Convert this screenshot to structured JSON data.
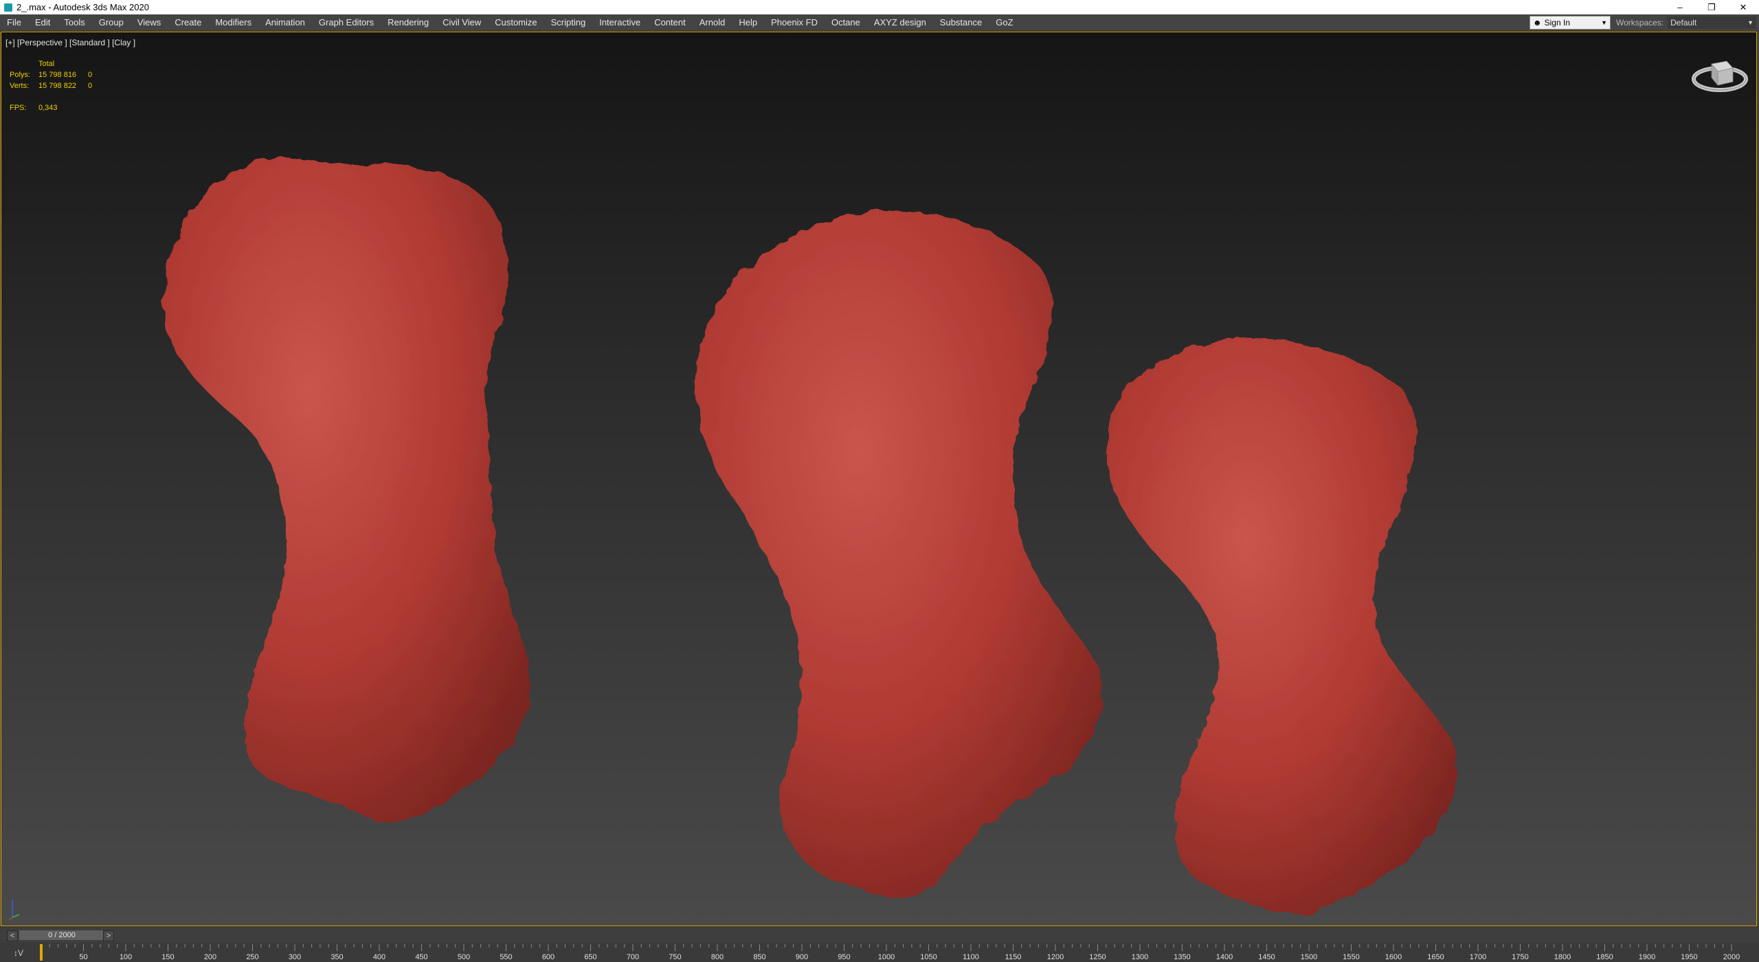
{
  "window": {
    "title": "2_.max - Autodesk 3ds Max 2020",
    "controls": {
      "minimize": "–",
      "restore": "❐",
      "close": "✕"
    }
  },
  "menu": {
    "items": [
      "File",
      "Edit",
      "Tools",
      "Group",
      "Views",
      "Create",
      "Modifiers",
      "Animation",
      "Graph Editors",
      "Rendering",
      "Civil View",
      "Customize",
      "Scripting",
      "Interactive",
      "Content",
      "Arnold",
      "Help",
      "Phoenix FD",
      "Octane",
      "AXYZ design",
      "Substance",
      "GoZ"
    ]
  },
  "account": {
    "sign_in": "Sign In"
  },
  "workspaces": {
    "label": "Workspaces:",
    "value": "Default"
  },
  "viewport": {
    "label": "[+] [Perspective ] [Standard ] [Clay ]",
    "stats": {
      "total_header": "Total",
      "polys_label": "Polys:",
      "polys_total": "15 798 816",
      "polys_selected": "0",
      "verts_label": "Verts:",
      "verts_total": "15 798 822",
      "verts_selected": "0",
      "fps_label": "FPS:",
      "fps_value": "0,343"
    },
    "rock_color": "#b83a34",
    "border_color": "#e0a800"
  },
  "timeslider": {
    "frame": "0 / 2000",
    "prev": "<",
    "next": ">"
  },
  "trackbar": {
    "icon": "↕V",
    "ticks": [
      50,
      100,
      150,
      200,
      250,
      300,
      350,
      400,
      450,
      500,
      550,
      600,
      650,
      700,
      750,
      800,
      850,
      900,
      950,
      1000,
      1050,
      1100,
      1150,
      1200,
      1250,
      1300,
      1350,
      1400,
      1450,
      1500,
      1550,
      1600,
      1650,
      1700,
      1750,
      1800,
      1850,
      1900,
      1950,
      2000
    ],
    "max_frame": 2000
  }
}
